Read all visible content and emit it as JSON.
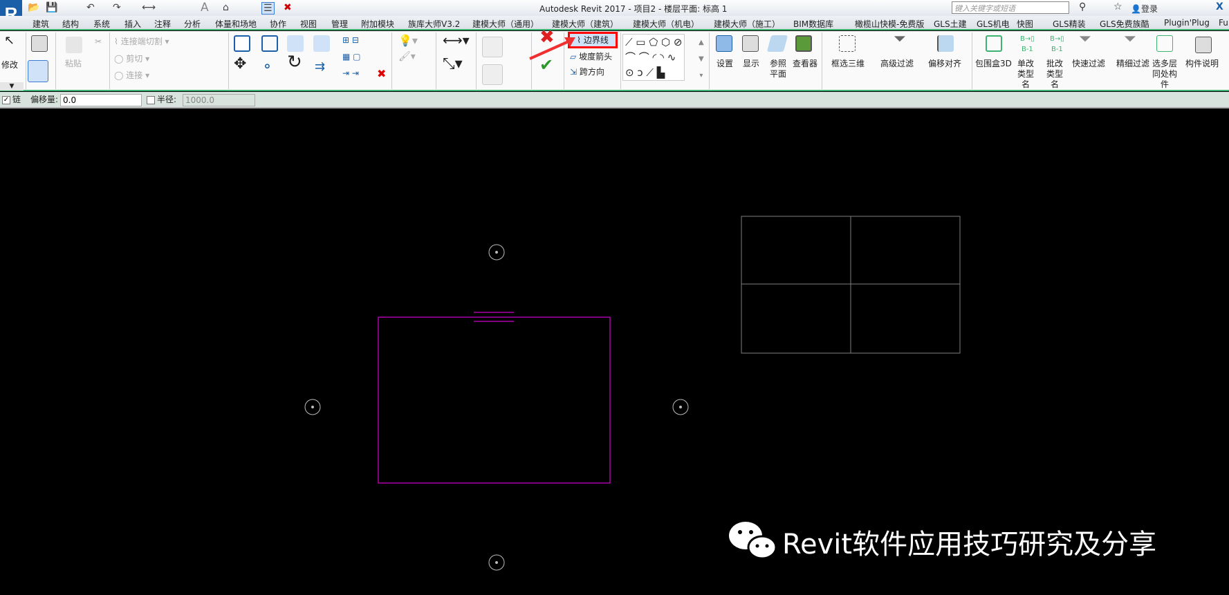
{
  "app": {
    "title": "Autodesk Revit 2017 -    项目2 - 楼层平面: 标高 1",
    "search_placeholder": "键入关键字或短语",
    "login": "登录"
  },
  "tabs": [
    "建筑",
    "结构",
    "系统",
    "插入",
    "注释",
    "分析",
    "体量和场地",
    "协作",
    "视图",
    "管理",
    "附加模块",
    "族库大师V3.2",
    "建模大师（通用）",
    "建模大师（建筑）",
    "建模大师（机电）",
    "建模大师（施工）",
    "BIM数据库",
    "橄榄山快模-免费版",
    "GLS土建",
    "GLS机电",
    "快图",
    "GLS精装",
    "GLS免费族酷",
    "Plugin'Plug",
    "Fu"
  ],
  "ribbon": {
    "modify": "修改",
    "paste": "粘贴",
    "join_cut": "连接端切割",
    "cut": "剪切",
    "join": "连接",
    "boundary_line": "边界线",
    "slope_arrow": "坡度箭头",
    "span_direction": "跨方向",
    "settings": "设置",
    "show": "显示",
    "ref_plane": "参照平面",
    "viewer": "查看器",
    "box_3d": "框选三维",
    "adv_filter": "高级过滤",
    "offset_align": "偏移对齐",
    "bbox_3d": "包围盒3D",
    "rename_single": "单改类型名",
    "rename_batch": "批改类型名",
    "quick_filter": "快速过滤",
    "fine_filter": "精细过滤",
    "multi_layer": "选多层同处构件",
    "comp_desc": "构件说明"
  },
  "options": {
    "chain_label": "链",
    "chain_checked": true,
    "offset_label": "偏移量:",
    "offset_value": "0.0",
    "radius_label": "半径:",
    "radius_checked": false,
    "radius_value": "1000.0"
  },
  "watermark": "Revit软件应用技巧研究及分享",
  "colors": {
    "sketch": "#ff00ff",
    "grid": "#808080",
    "highlight": "#ff0000",
    "accent": "#3cb371"
  }
}
